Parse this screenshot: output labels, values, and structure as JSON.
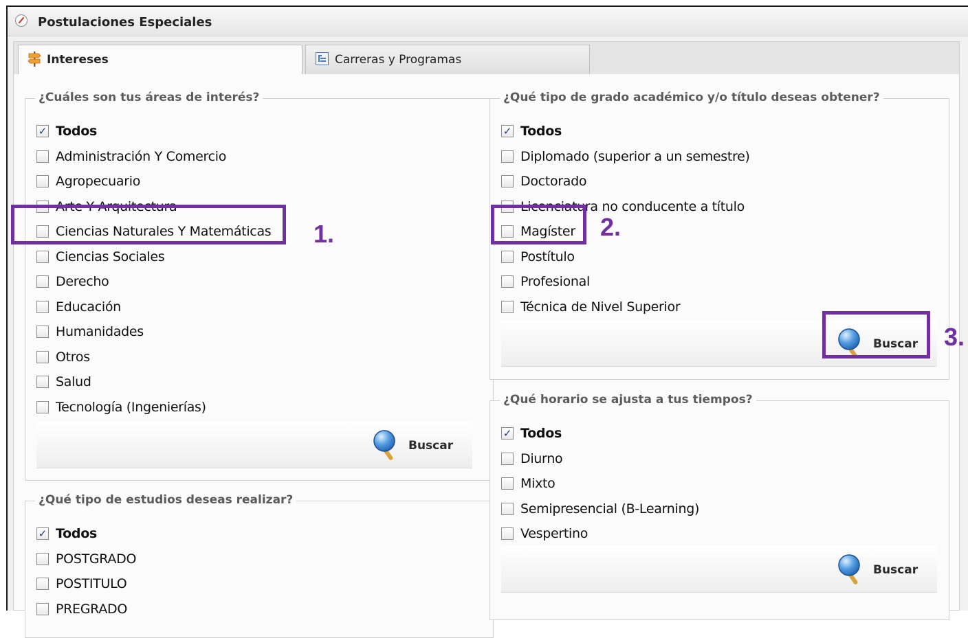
{
  "window": {
    "title": "Postulaciones Especiales"
  },
  "tabs": [
    {
      "label": "Intereses",
      "icon": "signpost-icon",
      "active": true
    },
    {
      "label": "Carreras y Programas",
      "icon": "tree-icon",
      "active": false
    }
  ],
  "areas": {
    "legend": "¿Cuáles son tus áreas de interés?",
    "options": [
      {
        "label": "Todos",
        "checked": true
      },
      {
        "label": "Administración Y Comercio",
        "checked": false
      },
      {
        "label": "Agropecuario",
        "checked": false
      },
      {
        "label": "Arte Y Arquitectura",
        "checked": false
      },
      {
        "label": "Ciencias Naturales Y Matemáticas",
        "checked": false
      },
      {
        "label": "Ciencias Sociales",
        "checked": false
      },
      {
        "label": "Derecho",
        "checked": false
      },
      {
        "label": "Educación",
        "checked": false
      },
      {
        "label": "Humanidades",
        "checked": false
      },
      {
        "label": "Otros",
        "checked": false
      },
      {
        "label": "Salud",
        "checked": false
      },
      {
        "label": "Tecnología (Ingenierías)",
        "checked": false
      }
    ],
    "button": "Buscar"
  },
  "estudios": {
    "legend": "¿Qué tipo de estudios deseas realizar?",
    "options": [
      {
        "label": "Todos",
        "checked": true
      },
      {
        "label": "POSTGRADO",
        "checked": false
      },
      {
        "label": "POSTITULO",
        "checked": false
      },
      {
        "label": "PREGRADO",
        "checked": false
      }
    ]
  },
  "grado": {
    "legend": "¿Qué tipo de grado académico y/o título deseas obtener?",
    "options": [
      {
        "label": "Todos",
        "checked": true
      },
      {
        "label": "Diplomado (superior a un semestre)",
        "checked": false
      },
      {
        "label": "Doctorado",
        "checked": false
      },
      {
        "label": "Licenciatura no conducente a título",
        "checked": false
      },
      {
        "label": "Magíster",
        "checked": false
      },
      {
        "label": "Postítulo",
        "checked": false
      },
      {
        "label": "Profesional",
        "checked": false
      },
      {
        "label": "Técnica de Nivel Superior",
        "checked": false
      }
    ],
    "button": "Buscar"
  },
  "horario": {
    "legend": "¿Qué horario se ajusta a tus tiempos?",
    "options": [
      {
        "label": "Todos",
        "checked": true
      },
      {
        "label": "Diurno",
        "checked": false
      },
      {
        "label": "Mixto",
        "checked": false
      },
      {
        "label": "Semipresencial (B-Learning)",
        "checked": false
      },
      {
        "label": "Vespertino",
        "checked": false
      }
    ],
    "button": "Buscar"
  },
  "annotations": {
    "step1": "1.",
    "step2": "2.",
    "step3": "3.",
    "color": "#7030a0"
  },
  "check_mark": "✓"
}
